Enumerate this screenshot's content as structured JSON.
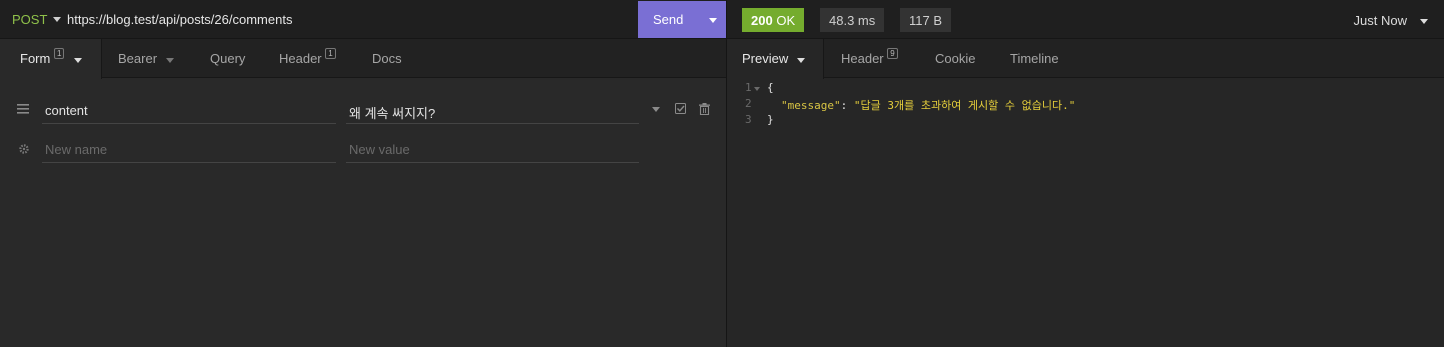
{
  "request": {
    "method": "POST",
    "url": "https://blog.test/api/posts/26/comments",
    "send_label": "Send"
  },
  "request_tabs": [
    {
      "label": "Form",
      "badge": "1"
    },
    {
      "label": "Bearer",
      "badge": ""
    },
    {
      "label": "Query",
      "badge": ""
    },
    {
      "label": "Header",
      "badge": "1"
    },
    {
      "label": "Docs",
      "badge": ""
    }
  ],
  "form": {
    "rows": [
      {
        "name": "content",
        "value": "왜 계속 써지지?"
      }
    ],
    "new_name_placeholder": "New name",
    "new_value_placeholder": "New value"
  },
  "response": {
    "status": "200",
    "status_text": "OK",
    "time": "48.3 ms",
    "size": "117 B",
    "history_label": "Just Now",
    "status_color": "#75ac2e"
  },
  "response_tabs": [
    {
      "label": "Preview",
      "badge": ""
    },
    {
      "label": "Header",
      "badge": "9"
    },
    {
      "label": "Cookie",
      "badge": ""
    },
    {
      "label": "Timeline",
      "badge": ""
    }
  ],
  "body_lines": [
    {
      "num": "1",
      "open": "{"
    },
    {
      "num": "2",
      "key": "\"message\"",
      "sep": ": ",
      "value": "\"답글 3개를 초과하여 게시할 수 없습니다.\""
    },
    {
      "num": "3",
      "close": "}"
    }
  ],
  "accent_color": "#7a6fd4"
}
